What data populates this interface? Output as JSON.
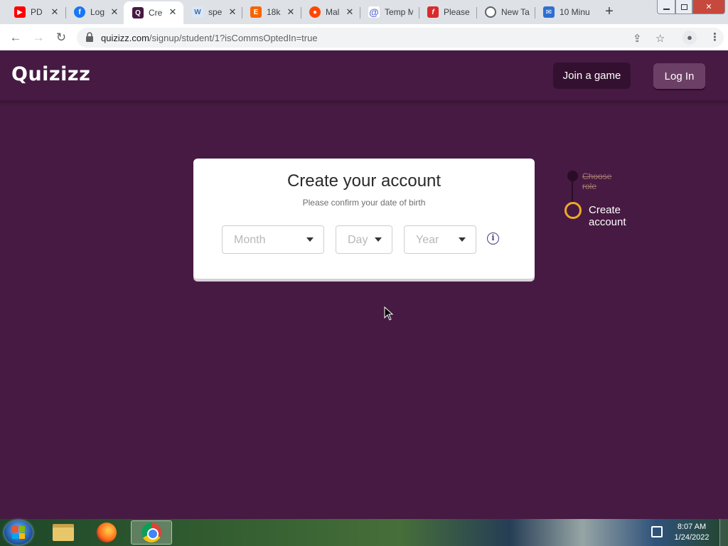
{
  "browser": {
    "tabs": [
      {
        "title": "PD",
        "icon": "youtube-icon",
        "color": "#ff0000"
      },
      {
        "title": "Log",
        "icon": "facebook-icon",
        "color": "#1877f2"
      },
      {
        "title": "Cre",
        "icon": "quizizz-icon",
        "color": "#461a42",
        "active": true
      },
      {
        "title": "spe",
        "icon": "w-icon",
        "color": "#3d6db5"
      },
      {
        "title": "18k",
        "icon": "e-icon",
        "color": "#f56400"
      },
      {
        "title": "Mal",
        "icon": "reddit-icon",
        "color": "#ff4500"
      },
      {
        "title": "Temp M",
        "icon": "at-icon",
        "color": "#5b6bd6"
      },
      {
        "title": "Please",
        "icon": "f-icon",
        "color": "#d92b2b"
      },
      {
        "title": "New Tab",
        "icon": "chrome-icon",
        "color": "#5f6368"
      },
      {
        "title": "10 Minu",
        "icon": "mail-icon",
        "color": "#2f6fd1"
      }
    ],
    "new_tab_symbol": "+",
    "close_symbol": "✕",
    "url_host": "quizizz.com",
    "url_path": "/signup/student/1?isCommsOptedIn=true"
  },
  "site": {
    "logo": "Quizizz",
    "join_label": "Join a game",
    "login_label": "Log In"
  },
  "card": {
    "title": "Create your account",
    "subtitle": "Please confirm your date of birth",
    "month_placeholder": "Month",
    "day_placeholder": "Day",
    "year_placeholder": "Year",
    "info_symbol": "i"
  },
  "steps": [
    {
      "label": "Choose role",
      "status": "done"
    },
    {
      "label": "Create account",
      "status": "current"
    }
  ],
  "taskbar": {
    "time": "8:07 AM",
    "date": "1/24/2022"
  }
}
